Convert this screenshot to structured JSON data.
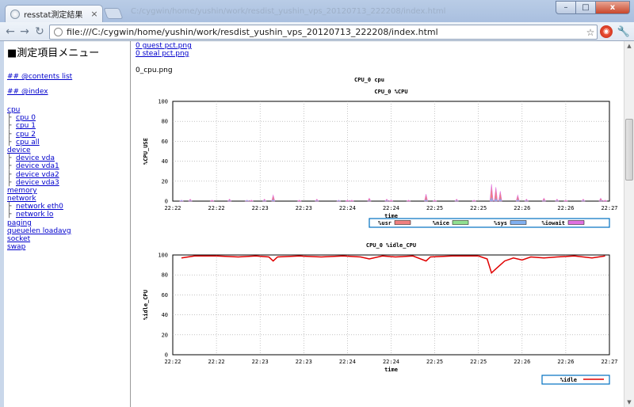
{
  "window": {
    "tab_title": "resstat測定結果",
    "tab_close": "×",
    "ghost_title": "C:/cygwin/home/yushin/work/resdist_yushin_vps_20120713_222208/index.html",
    "min_label": "–",
    "max_label": "□",
    "close_label": "x"
  },
  "toolbar": {
    "back": "←",
    "forward": "→",
    "reload": "↻",
    "url": "file:///C:/cygwin/home/yushin/work/resdist_yushin_vps_20120713_222208/index.html",
    "star": "☆",
    "ext_label": "◉",
    "wrench": "🔧"
  },
  "sidebar": {
    "title": "■測定項目メニュー",
    "contents_link": "## @contents list",
    "index_link": "## @index",
    "tree": [
      {
        "label": "cpu",
        "child": false
      },
      {
        "label": "cpu 0",
        "child": true
      },
      {
        "label": "cpu 1",
        "child": true
      },
      {
        "label": "cpu 2",
        "child": true
      },
      {
        "label": "cpu all",
        "child": true
      },
      {
        "label": "device",
        "child": false
      },
      {
        "label": "device vda",
        "child": true
      },
      {
        "label": "device vda1",
        "child": true
      },
      {
        "label": "device vda2",
        "child": true
      },
      {
        "label": "device vda3",
        "child": true
      },
      {
        "label": "memory",
        "child": false
      },
      {
        "label": "network",
        "child": false
      },
      {
        "label": "network eth0",
        "child": true
      },
      {
        "label": "network lo",
        "child": true
      },
      {
        "label": "paging",
        "child": false
      },
      {
        "label": "queuelen loadavg",
        "child": false
      },
      {
        "label": "socket",
        "child": false
      },
      {
        "label": "swap",
        "child": false
      }
    ],
    "branch_glyph": "├"
  },
  "main": {
    "links": [
      "0 guest pct.png",
      "0 steal pct.png"
    ],
    "file_name": "0_cpu.png",
    "figure_title": "CPU_0 cpu"
  },
  "colors": {
    "usr": "#f08080",
    "nice": "#90e090",
    "sys": "#80b0f0",
    "iowait": "#e070e0",
    "idle": "#e00000",
    "legend_border": "#0070c0"
  },
  "chart_data": [
    {
      "type": "area",
      "title": "CPU_0 %CPU",
      "xlabel": "time",
      "ylabel": "%CPU_USE",
      "ylim": [
        0,
        100
      ],
      "y_ticks": [
        0,
        20,
        40,
        60,
        80,
        100
      ],
      "x_ticks": [
        "22:22",
        "22:22",
        "22:23",
        "22:23",
        "22:24",
        "22:24",
        "22:25",
        "22:25",
        "22:26",
        "22:26",
        "22:27"
      ],
      "x_range_min": [
        0,
        5
      ],
      "grid": true,
      "legend_position": "bottom-right",
      "legend": [
        "%usr",
        "%nice",
        "%sys",
        "%iowait"
      ],
      "x": [
        0.2,
        0.4,
        0.9,
        1.3,
        1.7,
        1.8,
        2.1,
        2.3,
        2.9,
        3.3,
        3.8,
        4.0,
        4.1,
        4.5,
        4.9,
        5.0,
        5.4,
        5.8,
        6.0,
        6.5,
        6.9,
        7.3,
        7.4,
        7.5,
        7.9,
        8.1,
        8.5,
        8.8,
        9.0,
        9.4,
        9.8,
        9.9
      ],
      "series": [
        {
          "name": "%usr",
          "values": [
            1,
            2,
            1,
            2,
            1,
            1,
            2,
            6,
            1,
            2,
            1,
            1,
            1,
            3,
            2,
            1,
            1,
            7,
            1,
            2,
            1,
            17,
            14,
            10,
            6,
            2,
            3,
            2,
            1,
            2,
            3,
            1
          ]
        },
        {
          "name": "%sys",
          "values": [
            1,
            1,
            0,
            1,
            1,
            0,
            1,
            2,
            0,
            1,
            1,
            0,
            0,
            1,
            1,
            0,
            0,
            2,
            0,
            1,
            0,
            4,
            3,
            3,
            2,
            1,
            1,
            1,
            0,
            1,
            1,
            0
          ]
        }
      ]
    },
    {
      "type": "line",
      "title": "CPU_0 %idle_CPU",
      "xlabel": "time",
      "ylabel": "%idle_CPU",
      "ylim": [
        0,
        100
      ],
      "y_ticks": [
        0,
        20,
        40,
        60,
        80,
        100
      ],
      "x_ticks": [
        "22:22",
        "22:22",
        "22:23",
        "22:23",
        "22:24",
        "22:24",
        "22:25",
        "22:25",
        "22:26",
        "22:26",
        "22:27"
      ],
      "grid": true,
      "legend_position": "bottom-right",
      "legend": [
        "%idle"
      ],
      "x": [
        0.2,
        0.5,
        1.0,
        1.5,
        1.9,
        2.2,
        2.3,
        2.4,
        2.9,
        3.4,
        3.9,
        4.3,
        4.5,
        4.8,
        5.1,
        5.5,
        5.8,
        5.9,
        6.4,
        7.0,
        7.2,
        7.3,
        7.4,
        7.5,
        7.6,
        7.8,
        8.0,
        8.2,
        8.5,
        8.8,
        9.2,
        9.6,
        9.9
      ],
      "series": [
        {
          "name": "%idle",
          "values": [
            97,
            99,
            99,
            98,
            99,
            98,
            94,
            98,
            99,
            98,
            99,
            98,
            96,
            99,
            98,
            99,
            94,
            98,
            99,
            99,
            96,
            82,
            86,
            90,
            94,
            97,
            95,
            98,
            97,
            98,
            99,
            97,
            99
          ]
        }
      ]
    }
  ]
}
